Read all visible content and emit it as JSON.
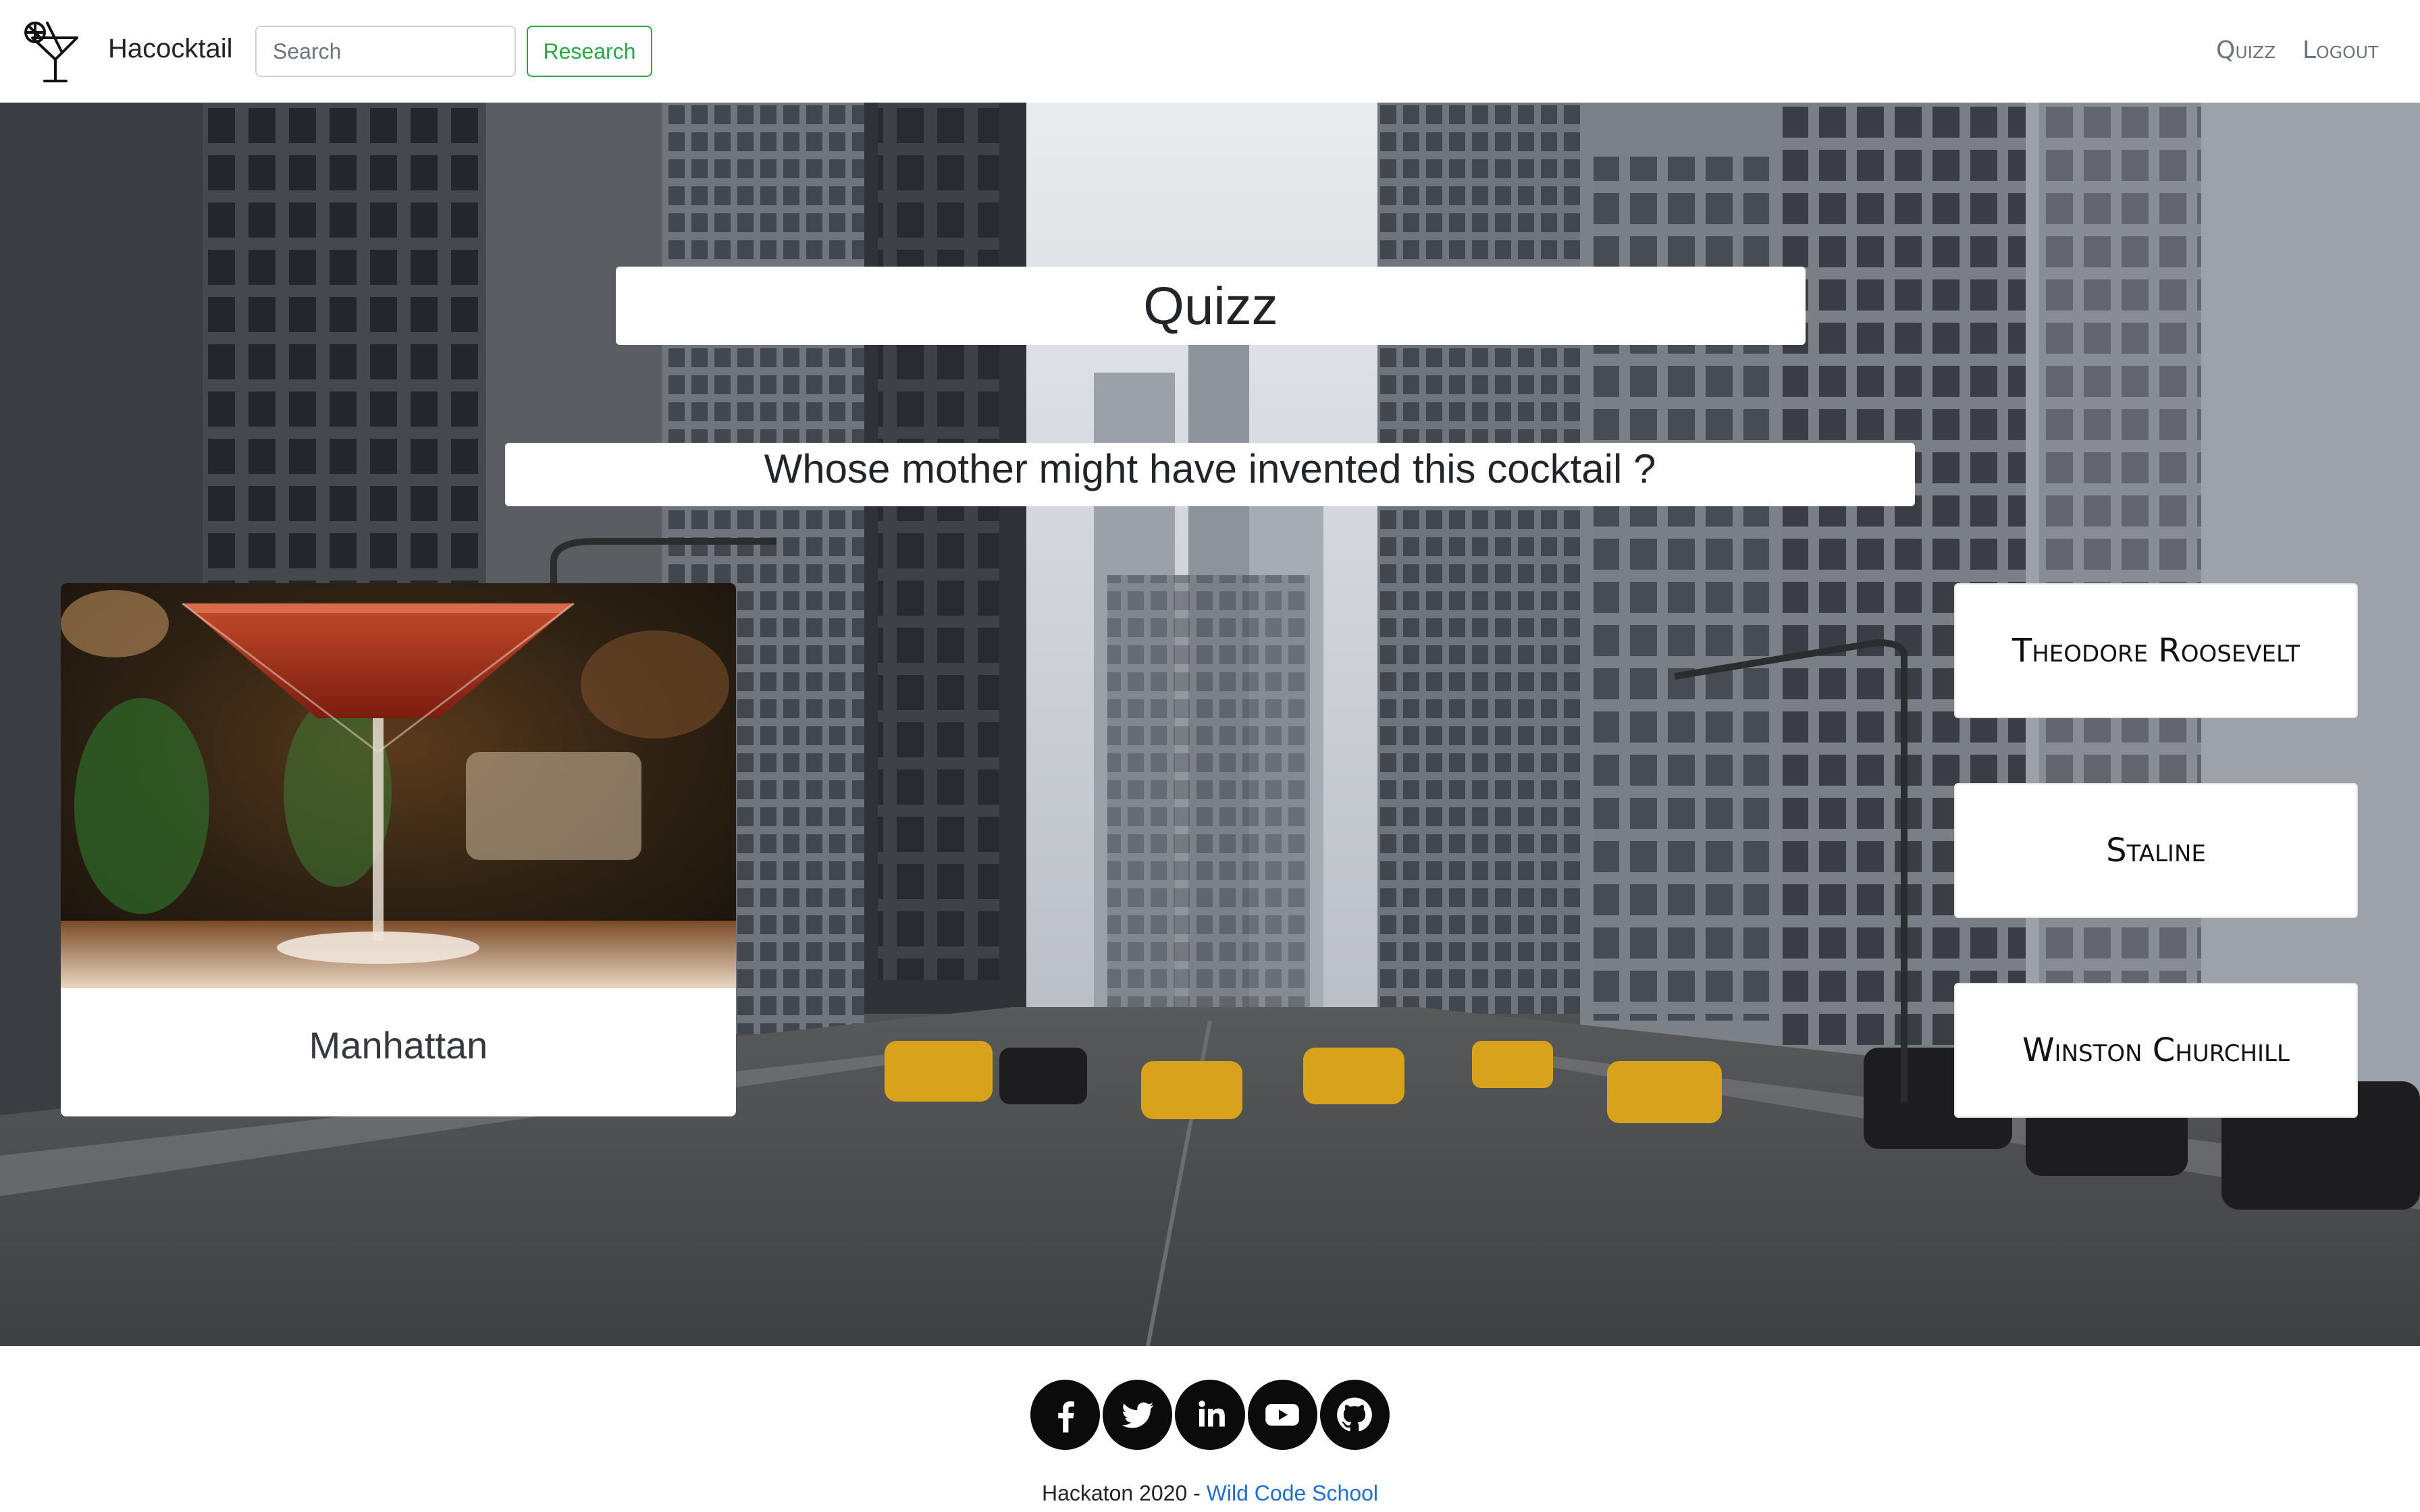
{
  "navbar": {
    "brand": "Hacocktail",
    "search_placeholder": "Search",
    "research_label": "Research",
    "links": {
      "quizz": "Quizz",
      "logout": "Logout"
    }
  },
  "quiz": {
    "title": "Quizz",
    "question": "Whose mother might have invented this cocktail ?",
    "cocktail_name": "Manhattan",
    "answers": [
      "Theodore Roosevelt",
      "Staline",
      "Winston Churchill"
    ]
  },
  "footer": {
    "socials": [
      "facebook-icon",
      "twitter-icon",
      "linkedin-icon",
      "youtube-icon",
      "github-icon"
    ],
    "copyright_prefix": "Hackaton 2020 - ",
    "link_text": "Wild Code School"
  },
  "colors": {
    "research_green": "#28a745",
    "link_blue": "#1f6fd1",
    "social_black": "#0b0b0b"
  }
}
